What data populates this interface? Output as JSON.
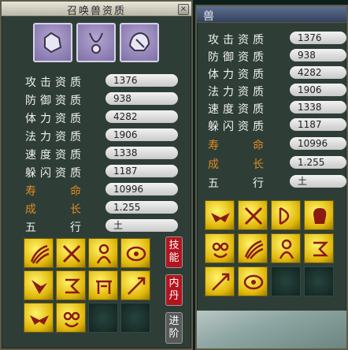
{
  "left_window": {
    "title": "召唤兽资质",
    "close_label": "×",
    "equip_slots": [
      {
        "icon": "armor-icon"
      },
      {
        "icon": "necklace-icon"
      },
      {
        "icon": "helmet-icon"
      }
    ],
    "stats": [
      {
        "label": "攻击资质",
        "value": "1376",
        "special": false
      },
      {
        "label": "防御资质",
        "value": "938",
        "special": false
      },
      {
        "label": "体力资质",
        "value": "4282",
        "special": false
      },
      {
        "label": "法力资质",
        "value": "1906",
        "special": false
      },
      {
        "label": "速度资质",
        "value": "1338",
        "special": false
      },
      {
        "label": "躲闪资质",
        "value": "1187",
        "special": false
      },
      {
        "label": "寿　　命",
        "value": "10996",
        "special": true
      },
      {
        "label": "成　　长",
        "value": "1.255",
        "special": true
      },
      {
        "label": "五　　行",
        "value": "土",
        "special": false
      }
    ],
    "skills": [
      "claw-slash-skill-icon",
      "cross-blade-skill-icon",
      "person-skill-icon",
      "eye-skill-icon",
      "wing-skill-icon",
      "rune-skill-icon",
      "gate-skill-icon",
      "arrow-skill-icon",
      "eagle-skill-icon",
      "owl-skill-icon",
      "empty",
      "empty"
    ],
    "side_buttons": [
      {
        "label": "技能",
        "color": "#b4141e"
      },
      {
        "label": "内丹",
        "color": "#b4141e"
      },
      {
        "label": "进阶",
        "color": "#565a58"
      }
    ]
  },
  "right_window": {
    "title": "兽",
    "stats": [
      {
        "label": "攻击资质",
        "value": "1376",
        "special": false
      },
      {
        "label": "防御资质",
        "value": "938",
        "special": false
      },
      {
        "label": "体力资质",
        "value": "4282",
        "special": false
      },
      {
        "label": "法力资质",
        "value": "1906",
        "special": false
      },
      {
        "label": "速度资质",
        "value": "1338",
        "special": false
      },
      {
        "label": "躲闪资质",
        "value": "1187",
        "special": false
      },
      {
        "label": "寿　　命",
        "value": "10996",
        "special": true
      },
      {
        "label": "成　　长",
        "value": "1.255",
        "special": true
      },
      {
        "label": "五　　行",
        "value": "土",
        "special": false
      }
    ],
    "skills": [
      "eagle-skill-icon",
      "cross-blade-skill-icon",
      "bow-skill-icon",
      "fist-skill-icon",
      "owl-skill-icon",
      "claw-slash-skill-icon",
      "person-skill-icon",
      "rune-skill-icon",
      "arrow-skill-icon",
      "eye-skill-icon",
      "empty",
      "empty"
    ]
  },
  "colors": {
    "panel_bg": "#2e3e37",
    "special_label": "#e08a24",
    "skill_gold": "#e0b70a",
    "skill_glyph": "#8a1a10",
    "side_button_red": "#b4141e",
    "side_button_grey": "#565a58"
  }
}
